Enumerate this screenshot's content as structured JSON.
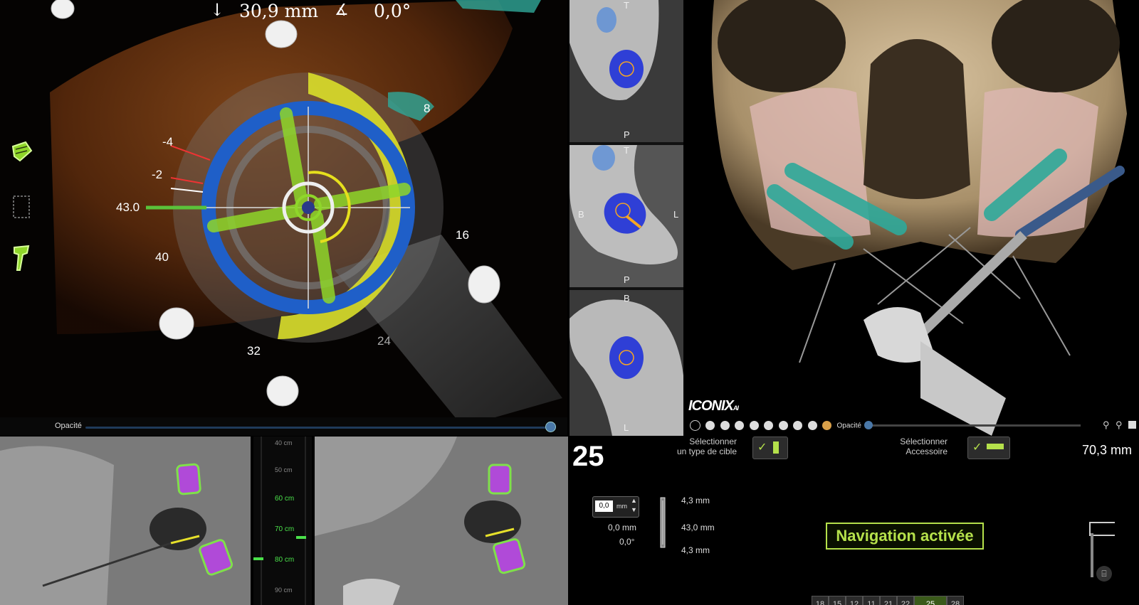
{
  "navigation_view": {
    "depth_value": "30,9 mm",
    "angle_value": "0,0°",
    "left_value": "43.0",
    "scale_labels": {
      "neg4": "-4",
      "neg2": "-2",
      "r40": "40",
      "r8": "8",
      "r16": "16",
      "r24": "24",
      "r32": "32"
    },
    "opacity_label": "Opacité"
  },
  "slices": {
    "top": {
      "top": "T",
      "bottom": "P"
    },
    "middle": {
      "top": "T",
      "left": "B",
      "right": "L",
      "bottom": "P"
    },
    "bottom": {
      "top": "B",
      "bottom": "L"
    }
  },
  "volume_view": {
    "logo": "ICONIX",
    "logo_suffix": "AI",
    "opacity_label": "Opacité"
  },
  "depth_ruler": {
    "labels": [
      "40 cm",
      "50 cm",
      "60 cm",
      "70 cm",
      "80 cm",
      "90 cm"
    ]
  },
  "control_panel": {
    "tooth_number": "25",
    "select_target_line1": "Sélectionner",
    "select_target_line2": "un type de cible",
    "select_accessory_line1": "Sélectionner",
    "select_accessory_line2": "Accessoire",
    "distance": "70,3 mm",
    "offset_input": "0,0",
    "offset_unit": "mm",
    "diameter_top": "4,3 mm",
    "length": "43,0 mm",
    "depth_offset": "0,0 mm",
    "angle_offset": "0,0°",
    "diameter_bottom": "4,3 mm",
    "navigation_status": "Navigation activée",
    "tooth_tabs": [
      "18",
      "15",
      "12",
      "11",
      "21",
      "22",
      "25",
      "28"
    ]
  },
  "colors": {
    "accent_green": "#b5e14b",
    "ring_blue": "#2a6fd0",
    "ring_yellow": "#e0e23a",
    "implant_teal": "#2fa99a"
  }
}
